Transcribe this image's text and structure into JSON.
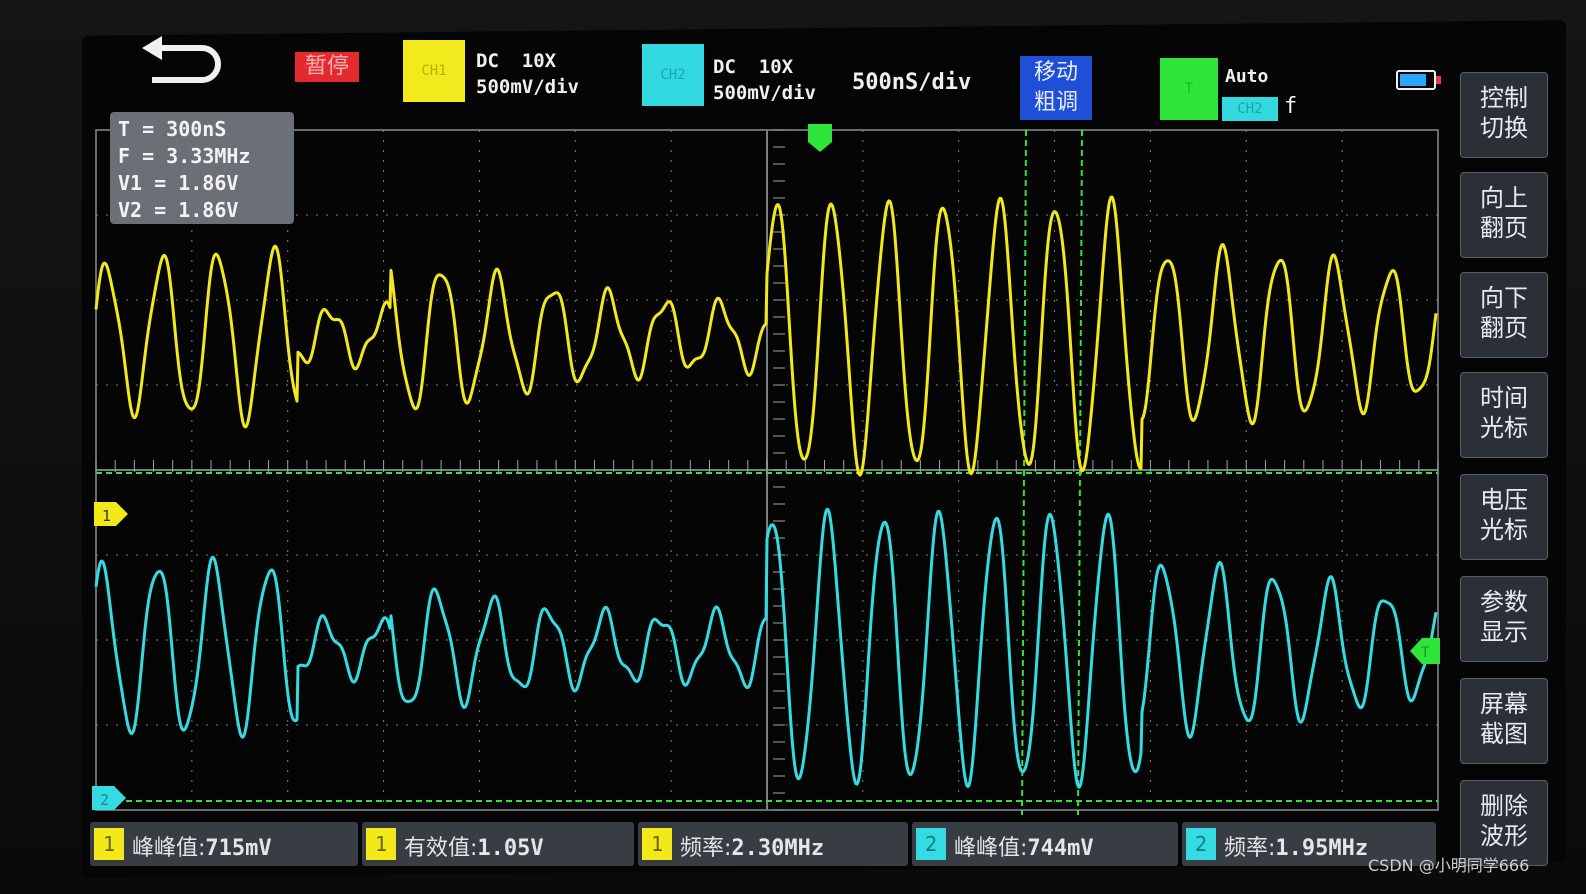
{
  "top": {
    "pause_label": "暂停",
    "ch1": {
      "box": "CH1",
      "line1": "DC  10X",
      "line2": "500mV/div"
    },
    "ch2": {
      "box": "CH2",
      "line1": "DC  10X",
      "line2": "500mV/div"
    },
    "timebase": "500nS/div",
    "move_mode": "移动\n粗调",
    "trigger": {
      "box": "T",
      "mode": "Auto",
      "source": "CH2",
      "edge": "f"
    },
    "battery_icon": "battery-icon"
  },
  "readout": {
    "t": "T = 300nS",
    "f": "F = 3.33MHz",
    "v1": "V1 = 1.86V",
    "v2": "V2 = 1.86V"
  },
  "side_buttons": [
    "控制\n切换",
    "向上\n翻页",
    "向下\n翻页",
    "时间\n光标",
    "电压\n光标",
    "参数\n显示",
    "屏幕\n截图",
    "删除\n波形"
  ],
  "markers": {
    "ch1": "1",
    "ch2": "2",
    "trigger_level": "T"
  },
  "measurements": [
    {
      "ch": "1",
      "label": "峰峰值:",
      "value": "715mV"
    },
    {
      "ch": "1",
      "label": "有效值:",
      "value": "1.05V"
    },
    {
      "ch": "1",
      "label": "频率:",
      "value": "2.30MHz"
    },
    {
      "ch": "2",
      "label": "峰峰值:",
      "value": "744mV"
    },
    {
      "ch": "2",
      "label": "频率:",
      "value": "1.95MHz"
    }
  ],
  "watermark": "CSDN @小明同学666",
  "colors": {
    "ch1": "#f2e81a",
    "ch2": "#35dbe3",
    "cursor": "#35e03a",
    "grid": "#9aa0a6",
    "measure_bg": "#383d44"
  }
}
